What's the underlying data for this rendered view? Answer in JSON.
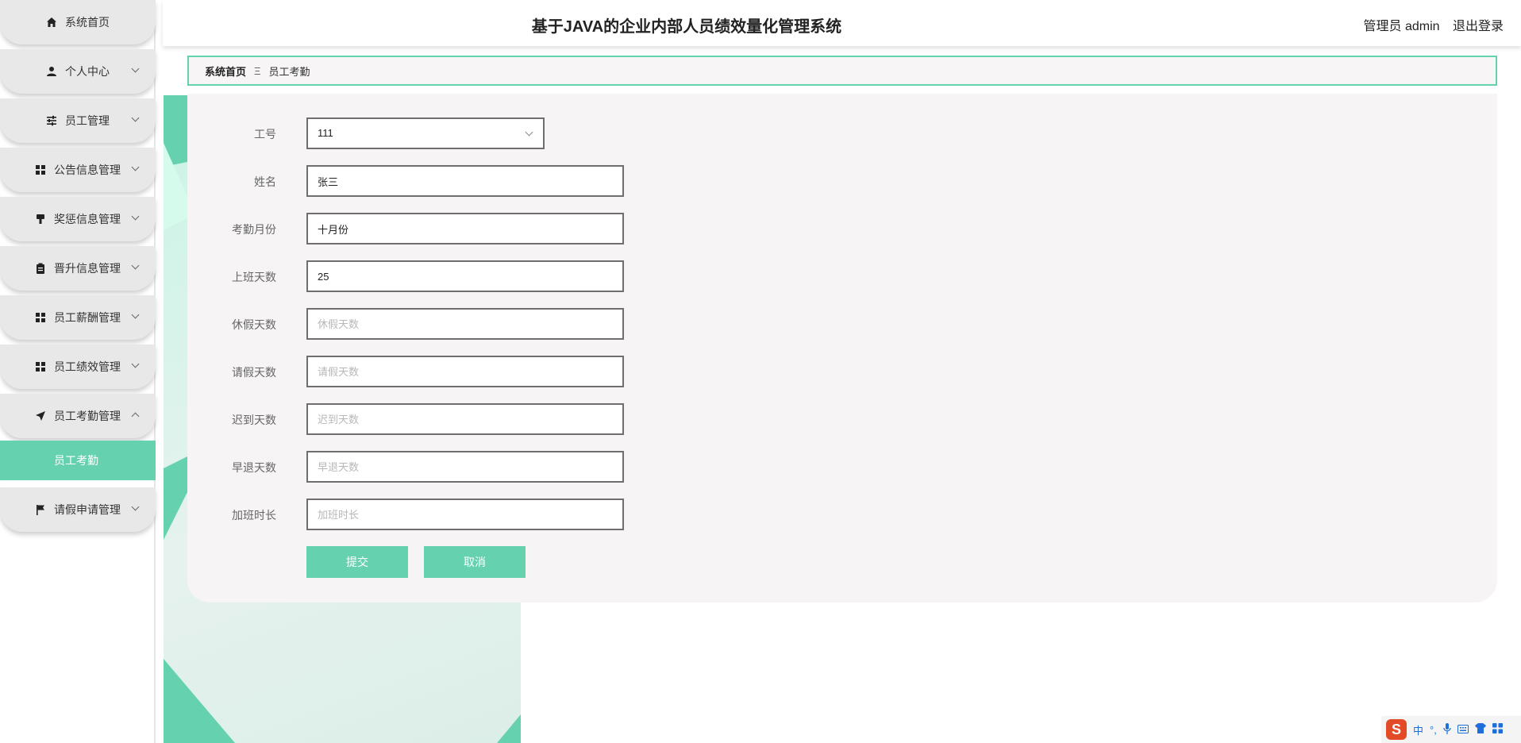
{
  "header": {
    "title": "基于JAVA的企业内部人员绩效量化管理系统",
    "user": "管理员 admin",
    "logout": "退出登录"
  },
  "sidebar": {
    "items": [
      {
        "label": "系统首页",
        "icon": "home-icon"
      },
      {
        "label": "个人中心",
        "icon": "person-icon"
      },
      {
        "label": "员工管理",
        "icon": "sliders-icon"
      },
      {
        "label": "公告信息管理",
        "icon": "grid-icon"
      },
      {
        "label": "奖惩信息管理",
        "icon": "brush-icon"
      },
      {
        "label": "晋升信息管理",
        "icon": "clipboard-icon"
      },
      {
        "label": "员工薪酬管理",
        "icon": "grid-icon"
      },
      {
        "label": "员工绩效管理",
        "icon": "grid-icon"
      },
      {
        "label": "员工考勤管理",
        "icon": "send-icon"
      },
      {
        "label": "请假申请管理",
        "icon": "flag-icon"
      }
    ],
    "active_sub": "员工考勤"
  },
  "breadcrumb": {
    "home": "系统首页",
    "separator": "Ξ",
    "current": "员工考勤"
  },
  "form": {
    "employee_id": {
      "label": "工号",
      "value": "111"
    },
    "name": {
      "label": "姓名",
      "value": "张三"
    },
    "month": {
      "label": "考勤月份",
      "value": "十月份"
    },
    "work_days": {
      "label": "上班天数",
      "value": "25"
    },
    "holiday_days": {
      "label": "休假天数",
      "placeholder": "休假天数"
    },
    "leave_days": {
      "label": "请假天数",
      "placeholder": "请假天数"
    },
    "late_days": {
      "label": "迟到天数",
      "placeholder": "迟到天数"
    },
    "early_days": {
      "label": "早退天数",
      "placeholder": "早退天数"
    },
    "overtime": {
      "label": "加班时长",
      "placeholder": "加班时长"
    },
    "submit": "提交",
    "cancel": "取消"
  },
  "ime": {
    "logo": "S",
    "lang": "中"
  },
  "colors": {
    "accent": "#66d1ae",
    "panel": "#f6f4f4",
    "nav": "#e8e8e8"
  }
}
